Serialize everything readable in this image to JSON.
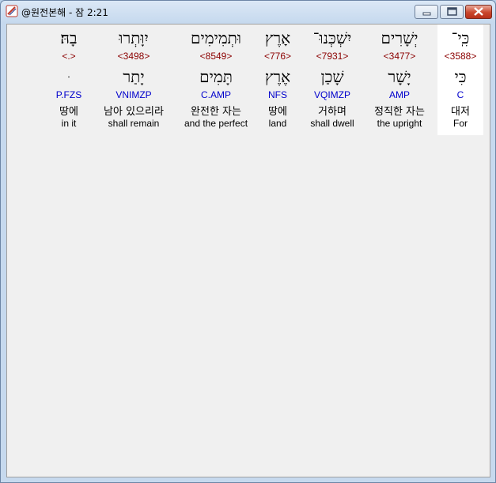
{
  "window": {
    "title": "@원전본해 - 잠 2:21"
  },
  "words": [
    {
      "hebrew": "כִּֽי־",
      "strong": "<3588>",
      "lemma": "כִּי",
      "morph": "C",
      "korean": "대저",
      "english": "For",
      "selected": true
    },
    {
      "hebrew": "יְשָׁרִים",
      "strong": "<3477>",
      "lemma": "יָשָׁר",
      "morph": "AMP",
      "korean": "정직한 자는",
      "english": "the upright",
      "selected": false
    },
    {
      "hebrew": "יִשְׁכְּנוּ־",
      "strong": "<7931>",
      "lemma": "שָׁכַן",
      "morph": "VQIMZP",
      "korean": "거하며",
      "english": "shall dwell",
      "selected": false
    },
    {
      "hebrew": "אָרֶץ",
      "strong": "<776>",
      "lemma": "אֶרֶץ",
      "morph": "NFS",
      "korean": "땅에",
      "english": "land",
      "selected": false
    },
    {
      "hebrew": "וּתְמִימִים",
      "strong": "<8549>",
      "lemma": "תָּמִים",
      "morph": "C.AMP",
      "korean": "완전한 자는",
      "english": "and the perfect",
      "selected": false
    },
    {
      "hebrew": "יִוָּתְרוּ",
      "strong": "<3498>",
      "lemma": "יָתַר",
      "morph": "VNIMZP",
      "korean": "남아 있으리라",
      "english": "shall remain",
      "selected": false
    },
    {
      "hebrew": "בָהּ׃",
      "strong": "<.>",
      "lemma": "ּ",
      "morph": "P.FZS",
      "korean": "땅에",
      "english": "in it",
      "selected": false
    }
  ]
}
